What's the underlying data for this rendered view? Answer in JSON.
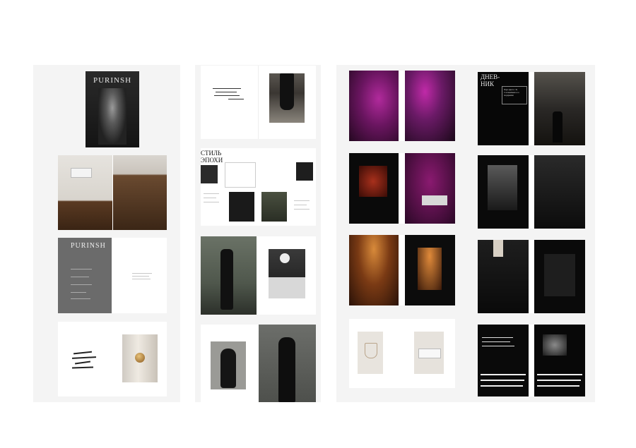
{
  "covers": {
    "brand": "PURINSH",
    "brand_second": "PURINSH"
  },
  "spreads": {
    "diary_title": "ДНЕВ-\nНИК",
    "style_title": "СТИЛЬ\nЭПОХИ",
    "quote_card": "Пара цвета с К. Соловьёвым и за подарками"
  },
  "colors": {
    "panel": "#f4f4f4",
    "page_white": "#ffffff",
    "page_black": "#0c0c0c",
    "neon_magenta": "#a0208a"
  }
}
